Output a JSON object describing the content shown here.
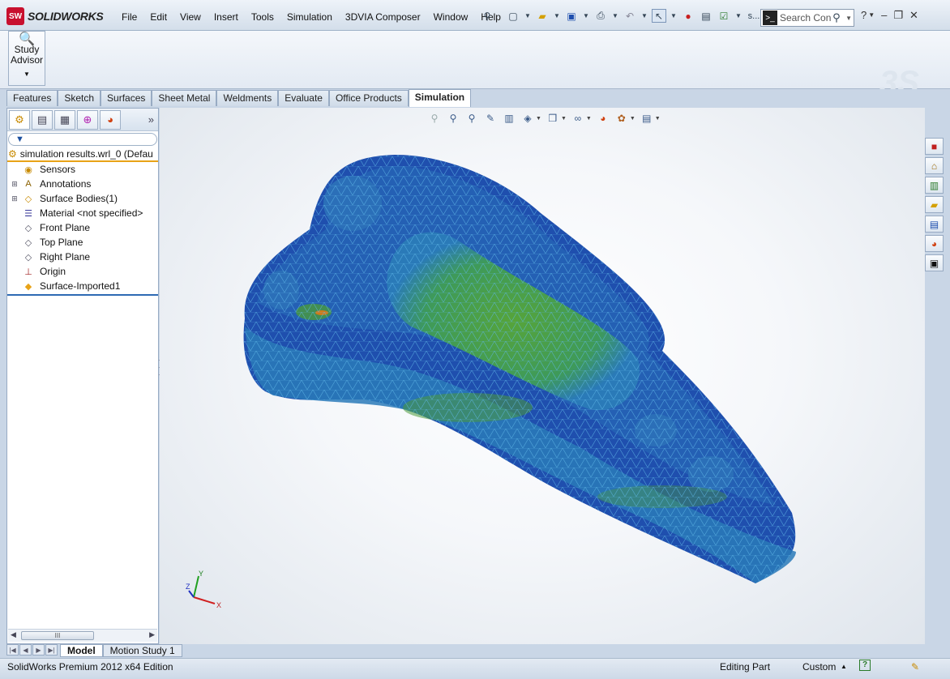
{
  "app": {
    "brand": "SOLIDWORKS",
    "brand_mark": "SW",
    "menus": [
      "File",
      "Edit",
      "View",
      "Insert",
      "Tools",
      "Simulation",
      "3DVIA Composer",
      "Window",
      "Help"
    ],
    "quick_icons": [
      "pin-icon",
      "new-document-icon",
      "open-icon",
      "save-icon",
      "print-icon",
      "undo-icon",
      "select-icon",
      "rebuild-icon",
      "file-properties-icon",
      "options-icon"
    ],
    "more_label": "s...",
    "search": {
      "placeholder": "Search Con"
    }
  },
  "ribbon": {
    "study_advisor": "Study Advisor"
  },
  "tabs": [
    "Features",
    "Sketch",
    "Surfaces",
    "Sheet Metal",
    "Weldments",
    "Evaluate",
    "Office Products",
    "Simulation"
  ],
  "active_tab": "Simulation",
  "feature_manager": {
    "more": "»",
    "root": "simulation results.wrl_0  (Defau",
    "items": [
      {
        "label": "Sensors",
        "icon": "sensor-icon",
        "expandable": false
      },
      {
        "label": "Annotations",
        "icon": "annotations-icon",
        "expandable": true
      },
      {
        "label": "Surface Bodies(1)",
        "icon": "surface-bodies-icon",
        "expandable": true
      },
      {
        "label": "Material <not specified>",
        "icon": "material-icon",
        "expandable": false
      },
      {
        "label": "Front Plane",
        "icon": "plane-icon",
        "expandable": false
      },
      {
        "label": "Top Plane",
        "icon": "plane-icon",
        "expandable": false
      },
      {
        "label": "Right Plane",
        "icon": "plane-icon",
        "expandable": false
      },
      {
        "label": "Origin",
        "icon": "origin-icon",
        "expandable": false
      },
      {
        "label": "Surface-Imported1",
        "icon": "imported-surface-icon",
        "expandable": false
      }
    ],
    "scroll_thumb": "III"
  },
  "triad": {
    "x": "X",
    "y": "Y",
    "z": "Z"
  },
  "bottom_tabs": [
    "Model",
    "Motion Study 1"
  ],
  "status": {
    "edition": "SolidWorks Premium 2012 x64 Edition",
    "mode": "Editing Part",
    "units": "Custom",
    "help": "?"
  },
  "colors": {
    "mesh_dark": "#1f4fae",
    "mesh_mid": "#2a8ac0",
    "mesh_green": "#4a9a3a",
    "accent_orange": "#e8a317"
  }
}
